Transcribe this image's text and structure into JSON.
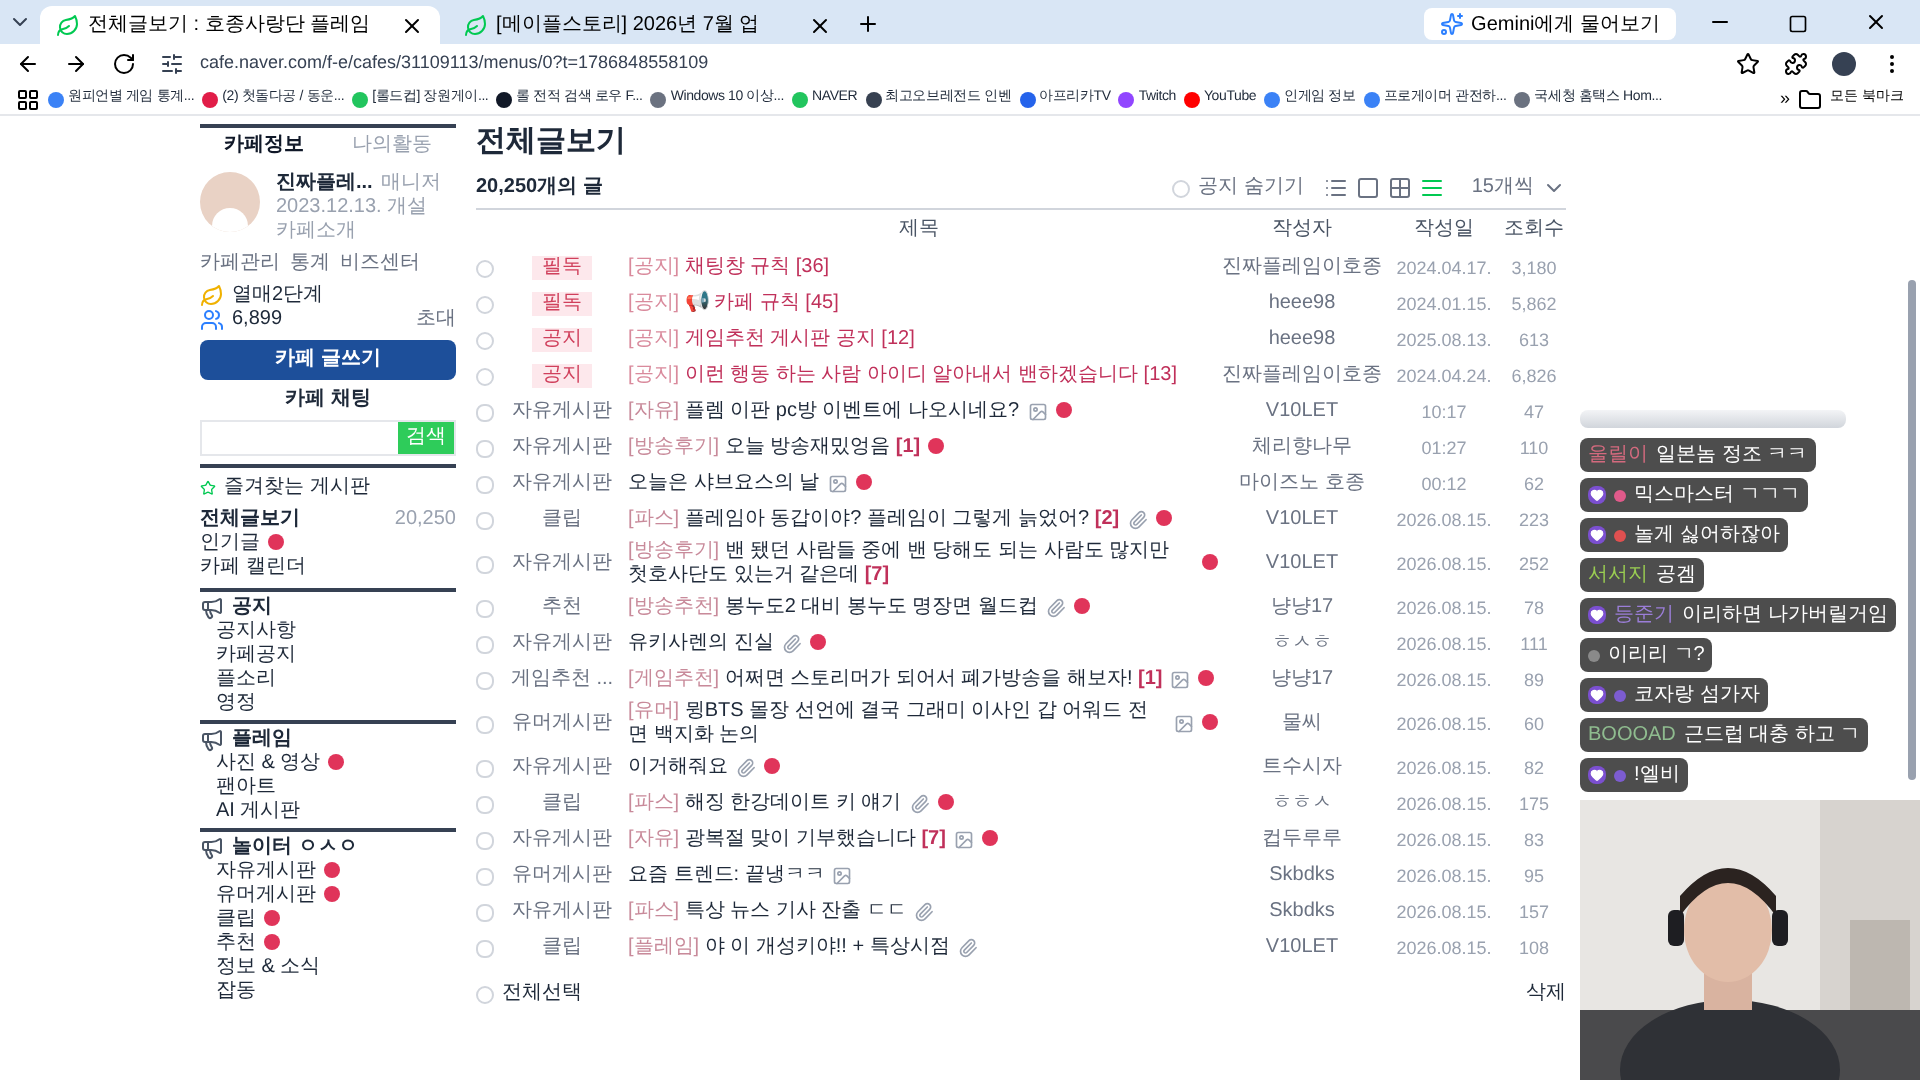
{
  "browser": {
    "tabs": [
      {
        "title": "전체글보기 : 호종사랑단 플레임",
        "selected": true
      },
      {
        "title": "[메이플스토리] 2026년 7월 업",
        "selected": false
      }
    ],
    "gemini": "Gemini에게 물어보기",
    "url": "cafe.naver.com/f-e/cafes/31109113/menus/0?t=1786848558109",
    "bookmarks": [
      {
        "label": "원피언별 게임 통계...",
        "color": "#3b82f6"
      },
      {
        "label": "(2) 첫돌다공 / 동운...",
        "color": "#e11d48"
      },
      {
        "label": "[롤드컵] 장원게이...",
        "color": "#22c55e"
      },
      {
        "label": "롤 전적 검색 로우 F...",
        "color": "#111827"
      },
      {
        "label": "Windows 10 이상...",
        "color": "#6b7280"
      },
      {
        "label": "NAVER",
        "color": "#22c55e"
      },
      {
        "label": "최고오브레전드 인벤",
        "color": "#374151"
      },
      {
        "label": "아프리카TV",
        "color": "#2563eb"
      },
      {
        "label": "Twitch",
        "color": "#9146ff"
      },
      {
        "label": "YouTube",
        "color": "#ff0000"
      },
      {
        "label": "인게임 정보",
        "color": "#3b82f6"
      },
      {
        "label": "프로게이머 관전하...",
        "color": "#3b82f6"
      },
      {
        "label": "국세청 홈택스 Hom...",
        "color": "#6b7280"
      }
    ],
    "more": "»",
    "all_bookmarks": "모든 북마크"
  },
  "sidebar": {
    "tabs": [
      {
        "label": "카페정보",
        "selected": true
      },
      {
        "label": "나의활동",
        "selected": false
      }
    ],
    "cafe_name": "진짜플레...",
    "role": "매니저",
    "founded": "2023.12.13. 개설",
    "intro": "카페소개",
    "links": [
      "카페관리",
      "통계",
      "비즈센터"
    ],
    "level": "열매2단계",
    "members": "6,899",
    "invite": "초대",
    "write_button": "카페 글쓰기",
    "chat": "카페 채팅",
    "search_button": "검색",
    "favorites": "즐겨찾는 게시판",
    "top_items": [
      {
        "label": "전체글보기",
        "count": "20,250",
        "is_new": false,
        "bold": true
      },
      {
        "label": "인기글",
        "is_new": true,
        "bold": false
      },
      {
        "label": "카페 캘린더",
        "is_new": false,
        "bold": false
      }
    ],
    "groups": [
      {
        "title": "공지",
        "items": [
          {
            "label": "공지사항",
            "is_new": false
          },
          {
            "label": "카페공지",
            "is_new": false
          },
          {
            "label": "플소리",
            "is_new": false
          },
          {
            "label": "영정",
            "is_new": false
          }
        ]
      },
      {
        "title": "플레임",
        "items": [
          {
            "label": "사진 & 영상",
            "is_new": true
          },
          {
            "label": "팬아트",
            "is_new": false
          },
          {
            "label": "AI 게시판",
            "is_new": false
          }
        ]
      },
      {
        "title": "놀이터 ㅇㅅㅇ",
        "items": [
          {
            "label": "자유게시판",
            "is_new": true
          },
          {
            "label": "유머게시판",
            "is_new": true
          },
          {
            "label": "클립",
            "is_new": true
          },
          {
            "label": "추천",
            "is_new": true
          },
          {
            "label": "정보 & 소식",
            "is_new": false
          },
          {
            "label": "잡동",
            "is_new": false
          }
        ]
      }
    ]
  },
  "main": {
    "title": "전체글보기",
    "count": "20,250개의 글",
    "hide_notice": {
      "label": "공지 숨기기",
      "checked": false
    },
    "view_modes": [
      {
        "selected": false
      },
      {
        "selected": false
      },
      {
        "selected": false
      },
      {
        "selected": true
      }
    ],
    "per_page": "15개씩",
    "columns": [
      "제목",
      "작성자",
      "작성일",
      "조회수"
    ],
    "rows": [
      {
        "kind": "notice",
        "checked": false,
        "category": "필독",
        "prefix": "[공지]",
        "text": "채팅창 규칙 [36]",
        "is_new": false,
        "author": "진짜플레임이호종",
        "date": "2024.04.17.",
        "views": "3,180"
      },
      {
        "kind": "notice",
        "checked": false,
        "category": "필독",
        "prefix": "[공지]",
        "text": "📢 카페 규칙 [45]",
        "is_new": false,
        "author": "heee98",
        "date": "2024.01.15.",
        "views": "5,862"
      },
      {
        "kind": "notice",
        "checked": false,
        "category": "공지",
        "prefix": "[공지]",
        "text": "게임추천 게시판 공지 [12]",
        "is_new": false,
        "author": "heee98",
        "date": "2025.08.13.",
        "views": "613"
      },
      {
        "kind": "notice",
        "checked": false,
        "category": "공지",
        "prefix": "[공지]",
        "text": "이런 행동 하는 사람 아이디 알아내서 밴하겠습니다 [13]",
        "is_new": false,
        "author": "진짜플레임이호종",
        "date": "2024.04.24.",
        "views": "6,826"
      },
      {
        "kind": "post",
        "checked": false,
        "category": "자유게시판",
        "prefix": "[자유]",
        "text": "플렘 이판 pc방 이벤트에 나오시네요?",
        "image": true,
        "clip": false,
        "is_new": true,
        "author": "V10LET",
        "date": "10:17",
        "views": "47"
      },
      {
        "kind": "post",
        "checked": false,
        "category": "자유게시판",
        "prefix": "[방송후기]",
        "text": "오늘 방송재밌엉음 **[1]**",
        "image": false,
        "clip": false,
        "is_new": true,
        "author": "체리향나무",
        "date": "01:27",
        "views": "110"
      },
      {
        "kind": "post",
        "checked": false,
        "category": "자유게시판",
        "text": "오늘은 샤브요스의 날",
        "image": true,
        "clip": false,
        "is_new": true,
        "author": "마이즈노 호종",
        "date": "00:12",
        "views": "62"
      },
      {
        "kind": "post",
        "checked": false,
        "category": "클립",
        "prefix": "[파스]",
        "text": "플레임아 동갑이야? 플레임이 그렇게 늙었어? **[2]**",
        "image": false,
        "clip": true,
        "is_new": true,
        "author": "V10LET",
        "date": "2026.08.15.",
        "views": "223"
      },
      {
        "kind": "post",
        "checked": false,
        "category": "자유게시판",
        "prefix": "[방송후기]",
        "text": "밴 됐던 사람들 중에 밴 당해도 되는 사람도 많지만 첫호사단도 있는거 같은데 **[7]**",
        "image": false,
        "clip": false,
        "is_new": true,
        "author": "V10LET",
        "date": "2026.08.15.",
        "views": "252"
      },
      {
        "kind": "post",
        "checked": false,
        "category": "추천",
        "prefix": "[방송추천]",
        "text": "봉누도2 대비 봉누도 명장면 월드컵",
        "image": false,
        "clip": true,
        "is_new": true,
        "author": "냥냥17",
        "date": "2026.08.15.",
        "views": "78"
      },
      {
        "kind": "post",
        "checked": false,
        "category": "자유게시판",
        "text": "유키사렌의 진실",
        "image": false,
        "clip": true,
        "is_new": true,
        "author": "ㅎㅅㅎ",
        "date": "2026.08.15.",
        "views": "111"
      },
      {
        "kind": "post",
        "checked": false,
        "category": "게임추천 ...",
        "prefix": "[게임추천]",
        "text": "어쩌면 스토리머가 되어서 폐가방송을 해보자! **[1]**",
        "image": true,
        "clip": false,
        "is_new": true,
        "author": "냥냥17",
        "date": "2026.08.15.",
        "views": "89"
      },
      {
        "kind": "post",
        "checked": false,
        "category": "유머게시판",
        "prefix": "[유머]",
        "text": "뮝BTS 몰장 선언에 결국 그래미 이사인 갑 어워드 전면 백지화 논의",
        "image": true,
        "clip": false,
        "is_new": true,
        "author": "물씨",
        "date": "2026.08.15.",
        "views": "60"
      },
      {
        "kind": "post",
        "checked": false,
        "category": "자유게시판",
        "text": "이거해줘요",
        "image": false,
        "clip": true,
        "is_new": true,
        "author": "트수시자",
        "date": "2026.08.15.",
        "views": "82"
      },
      {
        "kind": "post",
        "checked": false,
        "category": "클립",
        "prefix": "[파스]",
        "text": "해징 한강데이트 키 얘기",
        "image": false,
        "clip": true,
        "is_new": true,
        "author": "ㅎㅎㅅ",
        "date": "2026.08.15.",
        "views": "175"
      },
      {
        "kind": "post",
        "checked": false,
        "category": "자유게시판",
        "prefix": "[자유]",
        "text": "광복절 맞이 기부했습니다 **[7]**",
        "image": true,
        "clip": false,
        "is_new": true,
        "author": "컵두루루",
        "date": "2026.08.15.",
        "views": "83"
      },
      {
        "kind": "post",
        "checked": false,
        "category": "유머게시판",
        "text": "요즘 트렌드: 끝냉ㅋㅋ",
        "image": true,
        "clip": false,
        "is_new": false,
        "author": "Skbdks",
        "date": "2026.08.15.",
        "views": "95"
      },
      {
        "kind": "post",
        "checked": false,
        "category": "자유게시판",
        "prefix": "[파스]",
        "text": "특상 뉴스 기사 잔출 ㄷㄷ",
        "image": false,
        "clip": true,
        "is_new": false,
        "author": "Skbdks",
        "date": "2026.08.15.",
        "views": "157"
      },
      {
        "kind": "post",
        "checked": false,
        "category": "클립",
        "prefix": "[플레임]",
        "text": "야 이 개성키야!! + 특상시점",
        "image": false,
        "clip": true,
        "is_new": false,
        "author": "V10LET",
        "date": "2026.08.15.",
        "views": "108"
      }
    ],
    "select_all": {
      "label": "전체선택",
      "checked": false
    },
    "delete": "삭제"
  },
  "chat": [
    {
      "name": "울릴이",
      "text": "일본놈 정조 ㅋㅋ",
      "color": "#d46a7e",
      "badge": false
    },
    {
      "text": "믹스마스터 ㄱㄱㄱ",
      "color": "#e05a8a",
      "badge": true
    },
    {
      "text": "놀게 싫어하잖아",
      "color": "#e05050",
      "badge": true
    },
    {
      "name": "서서지",
      "text": "공겜",
      "color": "#9acd52",
      "badge": false
    },
    {
      "name": "등준기",
      "text": "이리하면 나가버릴거임",
      "color": "#9b7ed8",
      "badge": true
    },
    {
      "text": "이리리 ㄱ?",
      "color": "#8a8a8a",
      "badge": false
    },
    {
      "text": "코자랑 섬가자",
      "color": "#7c5cd0",
      "badge": true
    },
    {
      "name": "BOOOAD",
      "text": "근드럽 대충 하고 ㄱ",
      "color": "#8fbc8f",
      "badge": false
    },
    {
      "text": "!엘비",
      "color": "#7c5cd0",
      "badge": true
    }
  ]
}
